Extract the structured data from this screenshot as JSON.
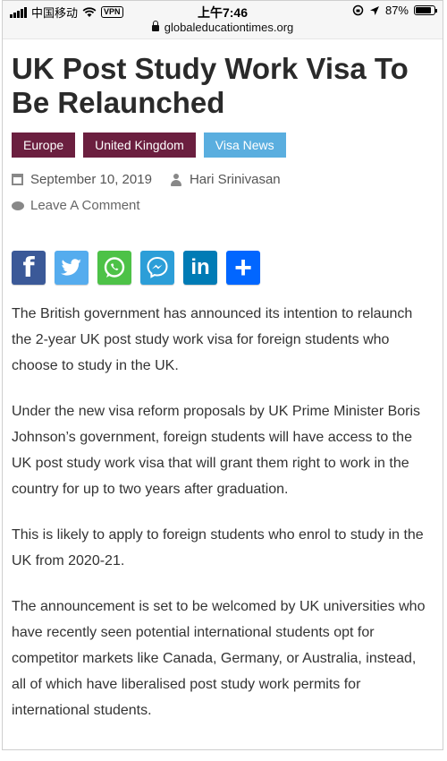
{
  "status_bar": {
    "carrier": "中国移动",
    "vpn": "VPN",
    "time": "上午7:46",
    "battery": "87%"
  },
  "browser": {
    "url": "globaleducationtimes.org"
  },
  "article": {
    "title": "UK Post Study Work Visa To Be Relaunched",
    "tags": [
      "Europe",
      "United Kingdom",
      "Visa News"
    ],
    "date": "September 10, 2019",
    "author": "Hari Srinivasan",
    "comment_link": "Leave A Comment",
    "paragraphs": [
      "The British government has announced its intention to relaunch the 2-year UK post study work visa for foreign students who choose to study in the UK.",
      "Under the new visa reform proposals by UK Prime Minister Boris Johnson’s government, foreign students will have access to the UK post study work visa that will grant them right to work in the country for up to two years after graduation.",
      "This is likely to apply to foreign students who enrol to study in the UK from 2020-21.",
      "The announcement is set to be welcomed by UK universities who have recently seen potential international students opt for competitor markets like Canada, Germany, or Australia, instead, all of which have liberalised post study work permits for international students."
    ]
  },
  "share_buttons": [
    {
      "icon": "facebook-icon",
      "glyph": "f",
      "color": "#3b5998"
    },
    {
      "icon": "twitter-icon",
      "color": "#55acee"
    },
    {
      "icon": "whatsapp-icon",
      "color": "#4dc247"
    },
    {
      "icon": "messenger-icon",
      "color": "#2c9ed8"
    },
    {
      "icon": "linkedin-icon",
      "glyph": "in",
      "color": "#007bb5"
    },
    {
      "icon": "plus-icon",
      "glyph": "+",
      "color": "#0166ff"
    }
  ],
  "battery_level": 0.87
}
